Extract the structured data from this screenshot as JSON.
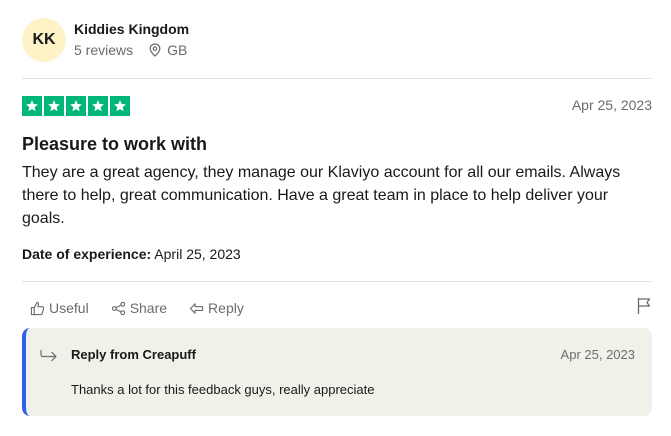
{
  "reviewer": {
    "initials": "KK",
    "name": "Kiddies Kingdom",
    "reviews_count": "5 reviews",
    "country": "GB"
  },
  "review": {
    "rating": 5,
    "max_rating": 5,
    "date": "Apr 25, 2023",
    "title": "Pleasure to work with",
    "body": "They are a great agency, they manage our Klaviyo account for all our emails. Always there to help, great communication. Have a great team in place to help deliver your goals.",
    "experience_label": "Date of experience:",
    "experience_date": "April 25, 2023",
    "star_color": "#00b67a"
  },
  "actions": {
    "useful": "Useful",
    "share": "Share",
    "reply": "Reply"
  },
  "reply": {
    "from": "Reply from Creapuff",
    "date": "Apr 25, 2023",
    "text": "Thanks a lot for this feedback guys, really appreciate",
    "accent_color": "#2f62e7"
  },
  "icons": [
    "location-pin-icon",
    "star-icon",
    "thumbs-up-icon",
    "share-icon",
    "reply-icon",
    "flag-icon",
    "reply-arrow-icon"
  ]
}
